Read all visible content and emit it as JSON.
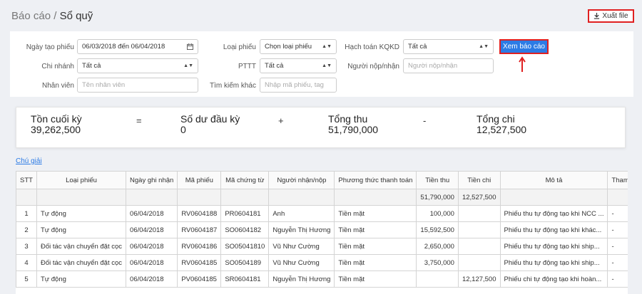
{
  "breadcrumb": {
    "parent": "Báo cáo /",
    "current": "Sổ quỹ"
  },
  "export_label": "Xuất file",
  "filters": {
    "ngay_tao_label": "Ngày tạo phiếu",
    "ngay_tao_value": "06/03/2018 đến 06/04/2018",
    "loai_phieu_label": "Loại phiếu",
    "loai_phieu_value": "Chọn loại phiếu",
    "hach_toan_label": "Hạch toán KQKD",
    "hach_toan_value": "Tất cả",
    "chi_nhanh_label": "Chi nhánh",
    "chi_nhanh_value": "Tất cả",
    "pttt_label": "PTTT",
    "pttt_value": "Tất cả",
    "nguoi_nop_label": "Người nộp/nhận",
    "nguoi_nop_placeholder": "Người nộp/nhận",
    "nhan_vien_label": "Nhân viên",
    "nhan_vien_placeholder": "Tên nhân viên",
    "tim_kiem_label": "Tìm kiếm khác",
    "tim_kiem_placeholder": "Nhập mã phiếu, tag",
    "report_button": "Xem báo cáo"
  },
  "summary": {
    "ton_cuoi_label": "Tồn cuối kỳ",
    "ton_cuoi_value": "39,262,500",
    "eq": "=",
    "so_du_label": "Số dư đầu kỳ",
    "so_du_value": "0",
    "plus": "+",
    "tong_thu_label": "Tổng thu",
    "tong_thu_value": "51,790,000",
    "minus": "-",
    "tong_chi_label": "Tổng chi",
    "tong_chi_value": "12,527,500"
  },
  "legend_link": "Chú giải",
  "table": {
    "headers": [
      "STT",
      "Loại phiếu",
      "Ngày ghi nhận",
      "Mã phiếu",
      "Mã chứng từ",
      "Người nhận/nộp",
      "Phương thức thanh toán",
      "Tiền thu",
      "Tiền chi",
      "Mô tả",
      "Tham chiếu"
    ],
    "totals": {
      "thu": "51,790,000",
      "chi": "12,527,500"
    },
    "rows": [
      [
        "1",
        "Tự động",
        "06/04/2018",
        "RV0604188",
        "PR0604181",
        "Anh",
        "Tiền mặt",
        "100,000",
        "",
        "Phiếu thu tự động tạo khi NCC ...",
        "-"
      ],
      [
        "2",
        "Tự động",
        "06/04/2018",
        "RV0604187",
        "SO0604182",
        "Nguyễn Thị Hương",
        "Tiền mặt",
        "15,592,500",
        "",
        "Phiếu thu tự động tạo khi khác...",
        "-"
      ],
      [
        "3",
        "Đối tác vận chuyển đặt cọc",
        "06/04/2018",
        "RV0604186",
        "SO05041810",
        "Vũ Như Cường",
        "Tiền mặt",
        "2,650,000",
        "",
        "Phiếu thu tự động tạo khi ship...",
        "-"
      ],
      [
        "4",
        "Đối tác vận chuyển đặt cọc",
        "06/04/2018",
        "RV0604185",
        "SO0504189",
        "Vũ Như Cường",
        "Tiền mặt",
        "3,750,000",
        "",
        "Phiếu thu tự động tạo khi ship...",
        "-"
      ],
      [
        "5",
        "Tự động",
        "06/04/2018",
        "PV0604185",
        "SR0604181",
        "Nguyễn Thị Hương",
        "Tiền mặt",
        "",
        "12,127,500",
        "Phiếu chi tự động tạo khi hoàn...",
        "-"
      ]
    ]
  }
}
